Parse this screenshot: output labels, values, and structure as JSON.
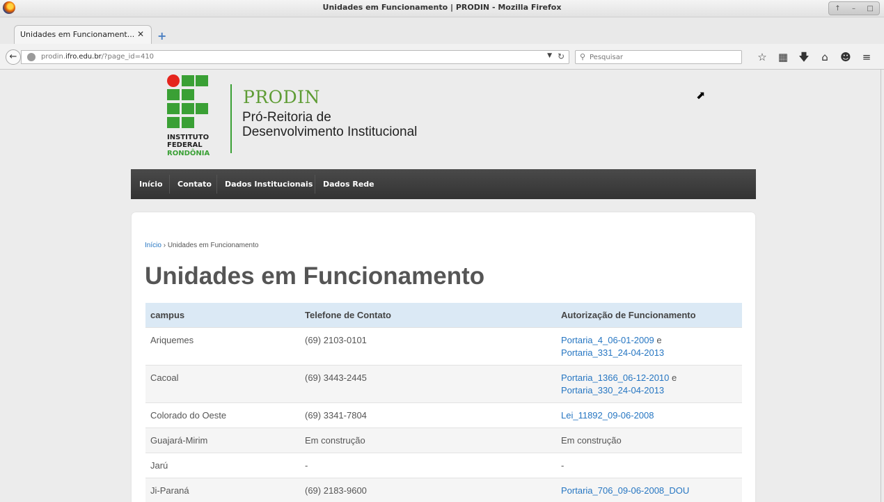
{
  "window": {
    "title": "Unidades em Funcionamento | PRODIN - Mozilla Firefox",
    "controls": [
      "↑",
      "–",
      "□"
    ]
  },
  "tab": {
    "label": "Unidades em Funcionament...",
    "close": "✕",
    "new_tab": "+"
  },
  "nav": {
    "url_host_prefix": "prodin.",
    "url_host_bold": "ifro.edu.br",
    "url_path": "/?page_id=410",
    "search_placeholder": "Pesquisar"
  },
  "header": {
    "logo_line1": "INSTITUTO",
    "logo_line2": "FEDERAL",
    "logo_line3": "RONDÔNIA",
    "title": "PRODIN",
    "subtitle_line1": "Pró-Reitoria de",
    "subtitle_line2": "Desenvolvimento Institucional"
  },
  "menu": {
    "items": [
      "Início",
      "Contato",
      "Dados Institucionais",
      "Dados Rede"
    ]
  },
  "breadcrumb": {
    "home": "Início",
    "separator": "›",
    "current": "Unidades em Funcionamento"
  },
  "page_title": "Unidades em Funcionamento",
  "table": {
    "headers": [
      "campus",
      "Telefone de Contato",
      "Autorização de Funcionamento"
    ],
    "rows": [
      {
        "campus": "Ariquemes",
        "phone": "(69) 2103-0101",
        "link1": "Portaria_4_06-01-2009",
        "conj": "e",
        "link2": "Portaria_331_24-04-2013"
      },
      {
        "campus": "Cacoal",
        "phone": "(69) 3443-2445",
        "link1": "Portaria_1366_06-12-2010",
        "conj": "e",
        "link2": "Portaria_330_24-04-2013"
      },
      {
        "campus": "Colorado do Oeste",
        "phone": "(69) 3341-7804",
        "link1": "Lei_11892_09-06-2008"
      },
      {
        "campus": "Guajará-Mirim",
        "phone": "Em construção",
        "text": "Em construção"
      },
      {
        "campus": "Jarú",
        "phone": "-",
        "text": "-"
      },
      {
        "campus": "Ji-Paraná",
        "phone": "(69) 2183-9600",
        "link1": "Portaria_706_09-06-2008_DOU"
      }
    ]
  },
  "colors": {
    "accent_green": "#5e9c34",
    "link_blue": "#2676c2",
    "menu_bg": "#3a3a3a",
    "table_header": "#dbe9f5",
    "logo_red": "#e5251d"
  }
}
